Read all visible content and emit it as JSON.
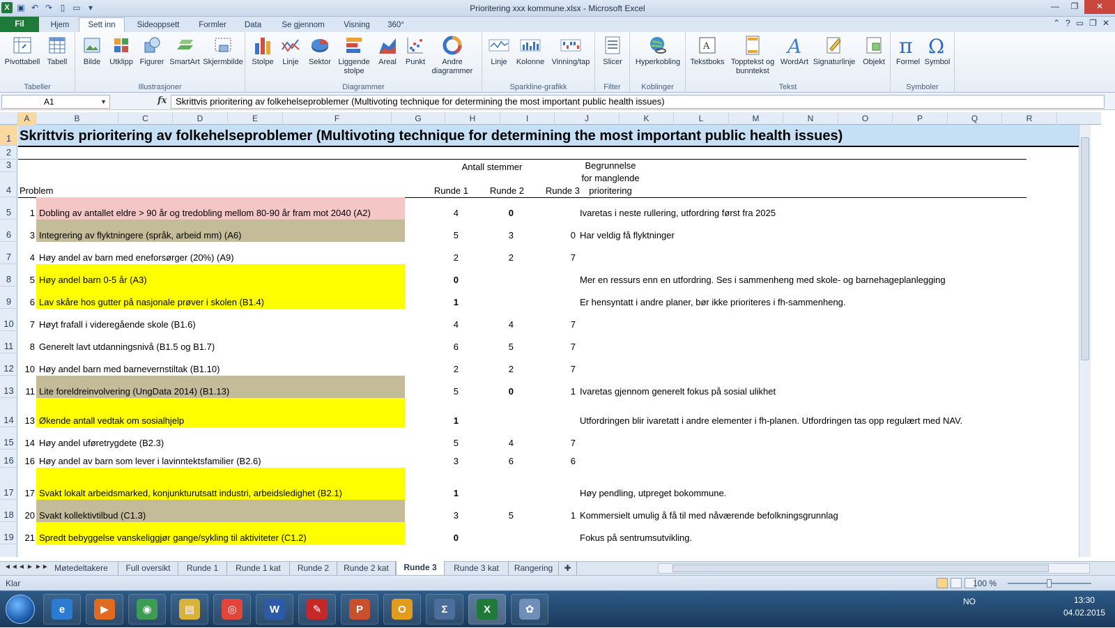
{
  "window": {
    "title": "Prioritering xxx kommune.xlsx  -  Microsoft Excel",
    "controls": [
      "minimize-icon",
      "maximize-icon",
      "close-icon"
    ]
  },
  "tabs": [
    "Fil",
    "Hjem",
    "Sett inn",
    "Sideoppsett",
    "Formler",
    "Data",
    "Se gjennom",
    "Visning",
    "360°"
  ],
  "active_tab": "Sett inn",
  "ribbon": {
    "groups": [
      {
        "name": "Tabeller",
        "buttons": [
          "Pivottabell",
          "Tabell"
        ]
      },
      {
        "name": "Illustrasjoner",
        "buttons": [
          "Bilde",
          "Utklipp",
          "Figurer",
          "SmartArt",
          "Skjermbilde"
        ]
      },
      {
        "name": "Diagrammer",
        "buttons": [
          "Stolpe",
          "Linje",
          "Sektor",
          "Liggende stolpe",
          "Areal",
          "Punkt",
          "Andre diagrammer"
        ]
      },
      {
        "name": "Sparkline-grafikk",
        "buttons": [
          "Linje",
          "Kolonne",
          "Vinning/tap"
        ]
      },
      {
        "name": "Filter",
        "buttons": [
          "Slicer"
        ]
      },
      {
        "name": "Koblinger",
        "buttons": [
          "Hyperkobling"
        ]
      },
      {
        "name": "Tekst",
        "buttons": [
          "Tekstboks",
          "Topptekst og bunntekst",
          "WordArt",
          "Signaturlinje",
          "Objekt"
        ]
      },
      {
        "name": "Symboler",
        "buttons": [
          "Formel",
          "Symbol"
        ]
      }
    ]
  },
  "formula_bar": {
    "name_box": "A1",
    "fx": "fx",
    "content": "Skrittvis prioritering av folkehelseproblemer (Multivoting technique for determining the most important public health issues)"
  },
  "columns": [
    "A",
    "B",
    "C",
    "D",
    "E",
    "F",
    "G",
    "H",
    "I",
    "J",
    "K",
    "L",
    "M",
    "N",
    "O",
    "P",
    "Q",
    "R"
  ],
  "row_numbers": [
    "1",
    "2",
    "3",
    "4",
    "5",
    "6",
    "7",
    "8",
    "9",
    "10",
    "11",
    "12",
    "13",
    "14",
    "15",
    "16",
    "17",
    "18",
    "19"
  ],
  "sheet": {
    "title": "Skrittvis prioritering av folkehelseproblemer (Multivoting technique for determining the most important public health issues)",
    "antall_stemmer": "Antall stemmer",
    "begrunnelse": [
      "Begrunnelse",
      "for manglende",
      "prioritering"
    ],
    "headers": {
      "problem": "Problem",
      "runde1": "Runde 1",
      "runde2": "Runde 2",
      "runde3": "Runde 3"
    },
    "rows": [
      {
        "nr": "1",
        "problem": "Dobling av antallet eldre > 90 år og tredobling mellom 80-90 år fram mot 2040 (A2)",
        "r1": "4",
        "r2": "0",
        "r3": "",
        "begr": "Ivaretas i neste rullering, utfordring først fra 2025",
        "color": "#f4c7c6",
        "r2bold": true
      },
      {
        "nr": "3",
        "problem": "Integrering av flyktningere (språk, arbeid mm) (A6)",
        "r1": "5",
        "r2": "3",
        "r3": "0",
        "begr": "Har veldig få flyktninger",
        "color": "#c4bc98"
      },
      {
        "nr": "4",
        "problem": "Høy andel av barn med eneforsørger (20%) (A9)",
        "r1": "2",
        "r2": "2",
        "r3": "7",
        "begr": "",
        "color": ""
      },
      {
        "nr": "5",
        "problem": "Høy andel barn 0-5 år (A3)",
        "r1": "0",
        "r2": "",
        "r3": "",
        "begr": "Mer en ressurs enn en utfordring. Ses i sammenheng med skole- og barnehageplanlegging",
        "color": "#ffff00",
        "r1bold": true
      },
      {
        "nr": "6",
        "problem": "Lav skåre hos gutter på nasjonale prøver i skolen (B1.4)",
        "r1": "1",
        "r2": "",
        "r3": "",
        "begr": "Er hensyntatt i andre planer, bør ikke prioriteres i fh-sammenheng.",
        "color": "#ffff00",
        "r1bold": true
      },
      {
        "nr": "7",
        "problem": "Høyt frafall i videregående skole (B1.6)",
        "r1": "4",
        "r2": "4",
        "r3": "7",
        "begr": "",
        "color": ""
      },
      {
        "nr": "8",
        "problem": "Generelt lavt utdanningsnivå (B1.5 og B1.7)",
        "r1": "6",
        "r2": "5",
        "r3": "7",
        "begr": "",
        "color": ""
      },
      {
        "nr": "10",
        "problem": "Høy andel barn med barnevernstiltak (B1.10)",
        "r1": "2",
        "r2": "2",
        "r3": "7",
        "begr": "",
        "color": ""
      },
      {
        "nr": "11",
        "problem": "Lite foreldreinvolvering (UngData 2014) (B1.13)",
        "r1": "5",
        "r2": "0",
        "r3": "1",
        "begr": "Ivaretas gjennom generelt fokus på sosial ulikhet",
        "color": "#c4bc98",
        "r2bold": true
      },
      {
        "nr": "13",
        "problem": "Økende antall vedtak om sosialhjelp",
        "r1": "1",
        "r2": "",
        "r3": "",
        "begr": "Utfordringen blir ivaretatt i andre elementer i fh-planen. Utfordringen tas opp regulært med NAV.",
        "color": "#ffff00",
        "r1bold": true
      },
      {
        "nr": "14",
        "problem": "Høy andel uføretrygdete (B2.3)",
        "r1": "5",
        "r2": "4",
        "r3": "7",
        "begr": "",
        "color": ""
      },
      {
        "nr": "16",
        "problem": "Høy andel av barn som lever i lavinntektsfamilier (B2.6)",
        "r1": "3",
        "r2": "6",
        "r3": "6",
        "begr": "",
        "color": ""
      },
      {
        "nr": "17",
        "problem": "Svakt lokalt arbeidsmarked, konjunkturutsatt industri, arbeidsledighet (B2.1)",
        "r1": "1",
        "r2": "",
        "r3": "",
        "begr": "Høy pendling, utpreget bokommune.",
        "color": "#ffff00",
        "r1bold": true
      },
      {
        "nr": "20",
        "problem": "Svakt kollektivtilbud (C1.3)",
        "r1": "3",
        "r2": "5",
        "r3": "1",
        "begr": "Kommersielt umulig å få til med nåværende befolkningsgrunnlag",
        "color": "#c4bc98"
      },
      {
        "nr": "21",
        "problem": "Spredt bebyggelse vanskeliggjør gange/sykling til aktiviteter (C1.2)",
        "r1": "0",
        "r2": "",
        "r3": "",
        "begr": "Fokus på sentrumsutvikling.",
        "color": "#ffff00",
        "r1bold": true
      }
    ]
  },
  "sheet_tabs": [
    "Møtedeltakere",
    "Full oversikt",
    "Runde 1",
    "Runde 1 kat",
    "Runde 2",
    "Runde 2 kat",
    "Runde 3",
    "Runde 3 kat",
    "Rangering"
  ],
  "active_sheet": "Runde 3",
  "status": {
    "ready": "Klar",
    "zoom": "100 %"
  },
  "taskbar": {
    "apps": [
      "Internet Explorer",
      "Media Player",
      "Nettverk",
      "Utforsker",
      "Chrome",
      "Word",
      "Adobe Reader",
      "PowerPoint",
      "Outlook",
      "Kalkulator",
      "Excel",
      "Paint"
    ],
    "language": "NO",
    "time": "13:30",
    "date": "04.02.2015"
  },
  "colors": {
    "pink": "#f4c7c6",
    "tan": "#c4bc98",
    "yellow": "#ffff00",
    "title_bg": "#c5e0f5",
    "excel_green": "#1f7a3a"
  }
}
